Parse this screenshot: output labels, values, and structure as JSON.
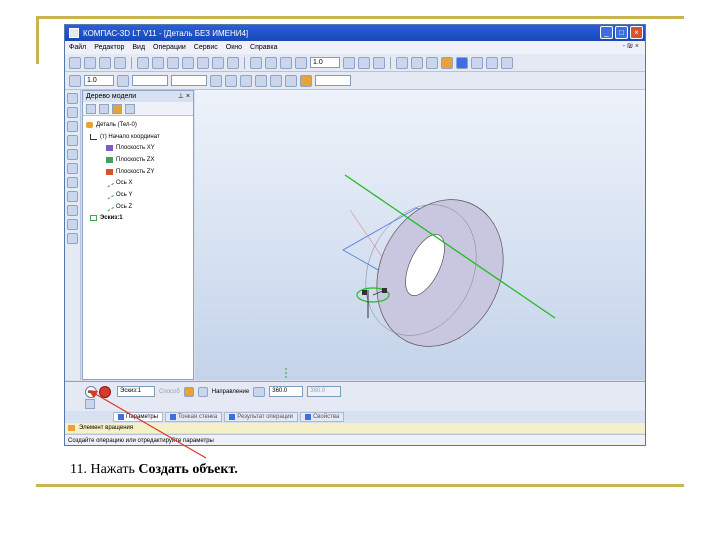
{
  "window": {
    "title": "КОМПАС-3D LT V11 - [Деталь БЕЗ ИМЕНИ4]",
    "controls": [
      "_",
      "□",
      "×"
    ]
  },
  "menu": {
    "items": [
      "Файл",
      "Редактор",
      "Вид",
      "Операции",
      "Сервис",
      "Окно",
      "Справка"
    ],
    "right": "- ₪ ×"
  },
  "toolbar": {
    "zoom_value": "1.0",
    "scale_value": "1.0"
  },
  "tree": {
    "header": "Дерево модели",
    "pin": "⊥ ×",
    "items": [
      {
        "label": "Деталь (Тел-0)",
        "level": 0,
        "icon": "part-icon"
      },
      {
        "label": "(т) Начало координат",
        "level": 1,
        "icon": "origin-icon"
      },
      {
        "label": "Плоскость XY",
        "level": 2,
        "icon": "plane-xy-icon"
      },
      {
        "label": "Плоскость ZX",
        "level": 2,
        "icon": "plane-zx-icon"
      },
      {
        "label": "Плоскость ZY",
        "level": 2,
        "icon": "plane-zy-icon"
      },
      {
        "label": "Ось X",
        "level": 2,
        "icon": "axis-icon"
      },
      {
        "label": "Ось Y",
        "level": 2,
        "icon": "axis-icon"
      },
      {
        "label": "Ось Z",
        "level": 2,
        "icon": "axis-icon"
      },
      {
        "label": "Эскиз:1",
        "level": 1,
        "icon": "sketch-icon"
      }
    ]
  },
  "properties": {
    "sketch_value": "Эскиз:1",
    "sketch_label_disabled": "Способ",
    "direction_label": "Направление",
    "angle_value": "360.0",
    "angle2_value": "360.0"
  },
  "tabs": [
    {
      "label": "Параметры",
      "active": true
    },
    {
      "label": "Тонкая стенка",
      "active": false
    },
    {
      "label": "Результат операции",
      "active": false
    },
    {
      "label": "Свойства",
      "active": false
    }
  ],
  "element_bar": "Элемент вращения",
  "statusbar": "Создайте операцию или отредактируйте параметры",
  "caption": {
    "prefix": "11. Нажать ",
    "bold": "Создать объект."
  },
  "colors": {
    "accent_line": "#c9b44e",
    "title_blue": "#2a5fd8",
    "torus_fill": "#c9c6e0",
    "axis_green": "#22bb22",
    "arrow_red": "#d83a2a"
  }
}
